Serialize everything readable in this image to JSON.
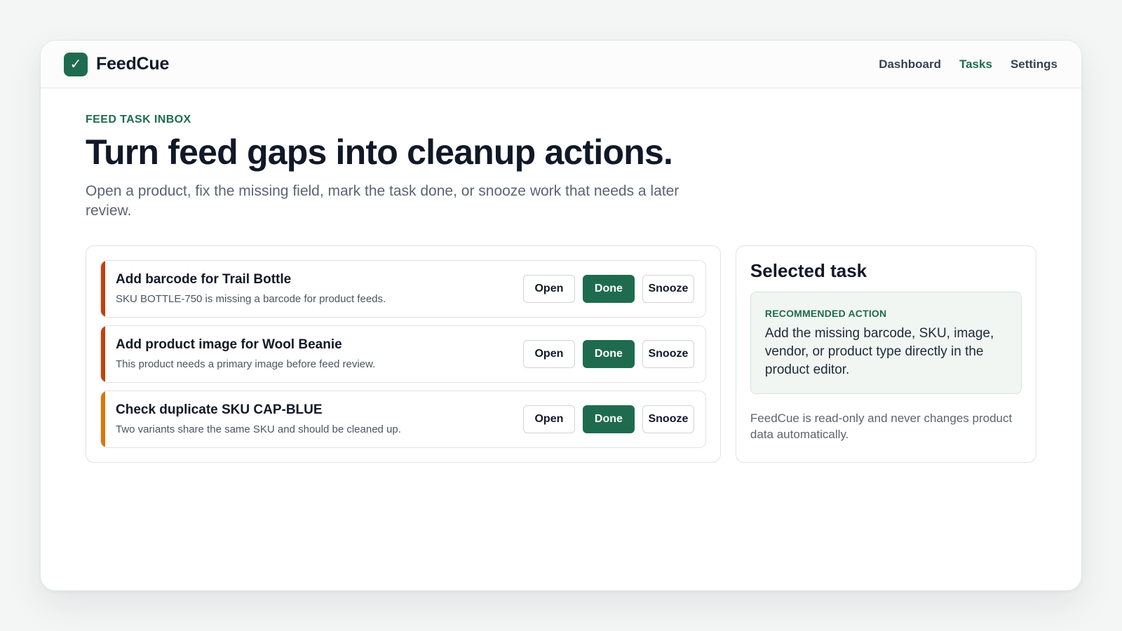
{
  "app": {
    "name": "FeedCue",
    "logo_glyph": "✓",
    "accent_color": "#1f6b4f"
  },
  "nav": {
    "items": [
      {
        "label": "Dashboard",
        "active": false
      },
      {
        "label": "Tasks",
        "active": true
      },
      {
        "label": "Settings",
        "active": false
      }
    ]
  },
  "hero": {
    "eyebrow": "FEED TASK INBOX",
    "headline": "Turn feed gaps into cleanup actions.",
    "subtitle": "Open a product, fix the missing field, mark the task done, or snooze work that needs a later review."
  },
  "tasks": [
    {
      "title": "Add barcode for Trail Bottle",
      "description": "SKU BOTTLE-750 is missing a barcode for product feeds.",
      "severity_color": "#c2410c"
    },
    {
      "title": "Add product image for Wool Beanie",
      "description": "This product needs a primary image before feed review.",
      "severity_color": "#c2410c"
    },
    {
      "title": "Check duplicate SKU CAP-BLUE",
      "description": "Two variants share the same SKU and should be cleaned up.",
      "severity_color": "#d97706"
    }
  ],
  "task_actions": {
    "open_label": "Open",
    "done_label": "Done",
    "snooze_label": "Snooze"
  },
  "selected": {
    "title": "Selected task",
    "recommended_label": "RECOMMENDED ACTION",
    "recommended_text": "Add the missing barcode, SKU, image, vendor, or product type directly in the product editor.",
    "note": "FeedCue is read-only and never changes product data automatically."
  }
}
